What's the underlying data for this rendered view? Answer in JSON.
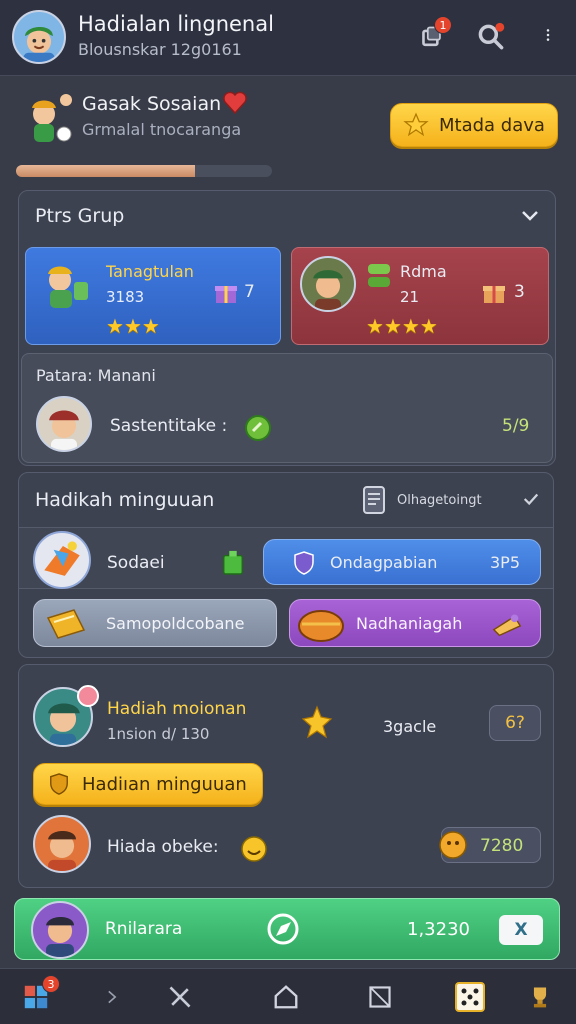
{
  "header": {
    "title": "Hadialan lingnenal",
    "subtitle": "Blousnskar 12g0161",
    "notif_badge": "1",
    "icons": [
      "avatar",
      "notification-icon",
      "search-icon",
      "more-icon"
    ]
  },
  "profile": {
    "name": "Gasak Sosaian",
    "subtitle": "Grmalal tnocaranga",
    "button_label": "Mtada dava",
    "progress": 0.7
  },
  "group": {
    "title": "Ptrs Grup",
    "team_left": {
      "name": "Tanagtulan",
      "score": "3183",
      "gift_count": "7",
      "stars": 3
    },
    "team_right": {
      "name": "Rdma",
      "score": "21",
      "gift_count": "3",
      "stars": 4
    },
    "member_header": "Patara: Manani",
    "member": {
      "name": "Sastentitake :",
      "value": "5/9"
    }
  },
  "weekly": {
    "title": "Hadikah minguuan",
    "option_label": "Olhagetoingt",
    "row1": {
      "label": "Sodaei",
      "pill_label": "Ondagpabian",
      "pill_value": "3P5"
    },
    "row2": {
      "left_label": "Samopoldcobane",
      "right_label": "Nadhaniagah"
    }
  },
  "reward": {
    "name": "Hadiah moionan",
    "sub": "1nsion d/ 130",
    "center_label": "3gacle",
    "box_value": "6?",
    "button_label": "Hadiıan minguuan",
    "row_name": "Hiada obeke:",
    "row_value": "7280"
  },
  "footer_bar": {
    "name": "Rnilarara",
    "value": "1,3230",
    "button": "X"
  },
  "bottom_nav": {
    "badge": "3"
  },
  "colors": {
    "bg": "#383c48",
    "blue_card": "#3a6fd0",
    "red_card": "#9c3d46",
    "yellow": "#f7be25",
    "green": "#3bbf73",
    "purple": "#9b56c9"
  }
}
